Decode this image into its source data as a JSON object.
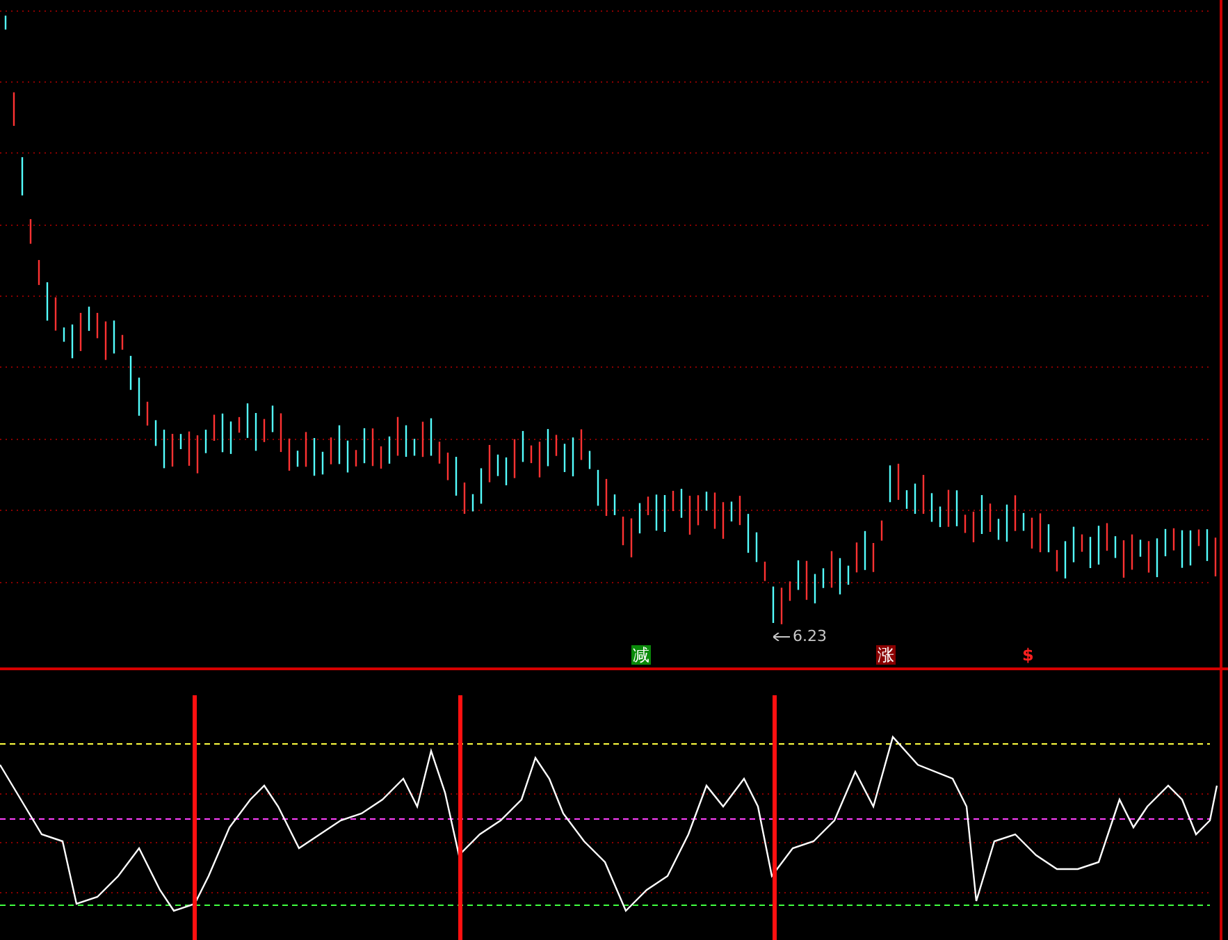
{
  "price_panel": {
    "low_label": "6.23",
    "signals": [
      {
        "text": "减",
        "kind": "reduce"
      },
      {
        "text": "涨",
        "kind": "rise"
      },
      {
        "text": "$",
        "kind": "dollar"
      }
    ]
  }
}
